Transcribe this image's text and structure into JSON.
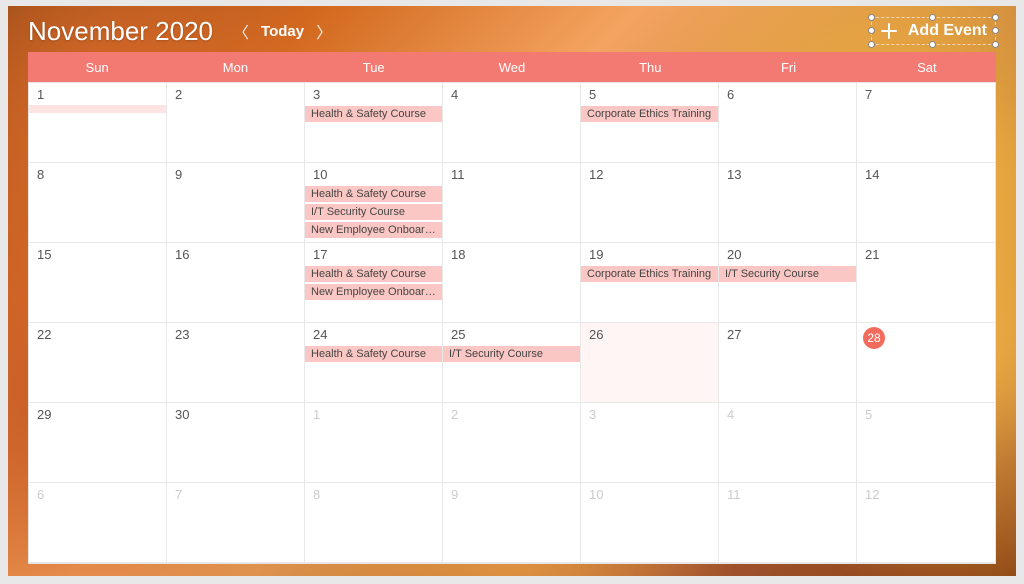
{
  "header": {
    "month_title": "November 2020",
    "today_label": "Today",
    "add_event_label": "Add Event"
  },
  "day_headers": [
    "Sun",
    "Mon",
    "Tue",
    "Wed",
    "Thu",
    "Fri",
    "Sat"
  ],
  "colors": {
    "accent": "#f37a72",
    "event_bg": "#fbc7c4"
  },
  "weeks": [
    [
      {
        "d": "1",
        "events": [],
        "stub": true
      },
      {
        "d": "2",
        "events": []
      },
      {
        "d": "3",
        "events": [
          "Health & Safety Course"
        ]
      },
      {
        "d": "4",
        "events": []
      },
      {
        "d": "5",
        "events": [
          "Corporate Ethics Training"
        ]
      },
      {
        "d": "6",
        "events": []
      },
      {
        "d": "7",
        "events": []
      }
    ],
    [
      {
        "d": "8",
        "events": []
      },
      {
        "d": "9",
        "events": []
      },
      {
        "d": "10",
        "events": [
          "Health & Safety Course",
          "I/T Security Course",
          "New Employee Onboardi..."
        ]
      },
      {
        "d": "11",
        "events": []
      },
      {
        "d": "12",
        "events": []
      },
      {
        "d": "13",
        "events": []
      },
      {
        "d": "14",
        "events": []
      }
    ],
    [
      {
        "d": "15",
        "events": []
      },
      {
        "d": "16",
        "events": []
      },
      {
        "d": "17",
        "events": [
          "Health & Safety Course",
          "New Employee Onboardi..."
        ]
      },
      {
        "d": "18",
        "events": []
      },
      {
        "d": "19",
        "events": [
          "Corporate Ethics Training"
        ]
      },
      {
        "d": "20",
        "events": [
          "I/T Security Course"
        ]
      },
      {
        "d": "21",
        "events": []
      }
    ],
    [
      {
        "d": "22",
        "events": []
      },
      {
        "d": "23",
        "events": []
      },
      {
        "d": "24",
        "events": [
          "Health & Safety Course"
        ]
      },
      {
        "d": "25",
        "events": [
          "I/T Security Course"
        ]
      },
      {
        "d": "26",
        "events": [],
        "today": true
      },
      {
        "d": "27",
        "events": []
      },
      {
        "d": "28",
        "events": [],
        "selected": true
      }
    ],
    [
      {
        "d": "29",
        "events": []
      },
      {
        "d": "30",
        "events": []
      },
      {
        "d": "1",
        "events": [],
        "out": true
      },
      {
        "d": "2",
        "events": [],
        "out": true
      },
      {
        "d": "3",
        "events": [],
        "out": true
      },
      {
        "d": "4",
        "events": [],
        "out": true
      },
      {
        "d": "5",
        "events": [],
        "out": true
      }
    ],
    [
      {
        "d": "6",
        "events": [],
        "out": true
      },
      {
        "d": "7",
        "events": [],
        "out": true
      },
      {
        "d": "8",
        "events": [],
        "out": true
      },
      {
        "d": "9",
        "events": [],
        "out": true
      },
      {
        "d": "10",
        "events": [],
        "out": true
      },
      {
        "d": "11",
        "events": [],
        "out": true
      },
      {
        "d": "12",
        "events": [],
        "out": true
      }
    ]
  ]
}
